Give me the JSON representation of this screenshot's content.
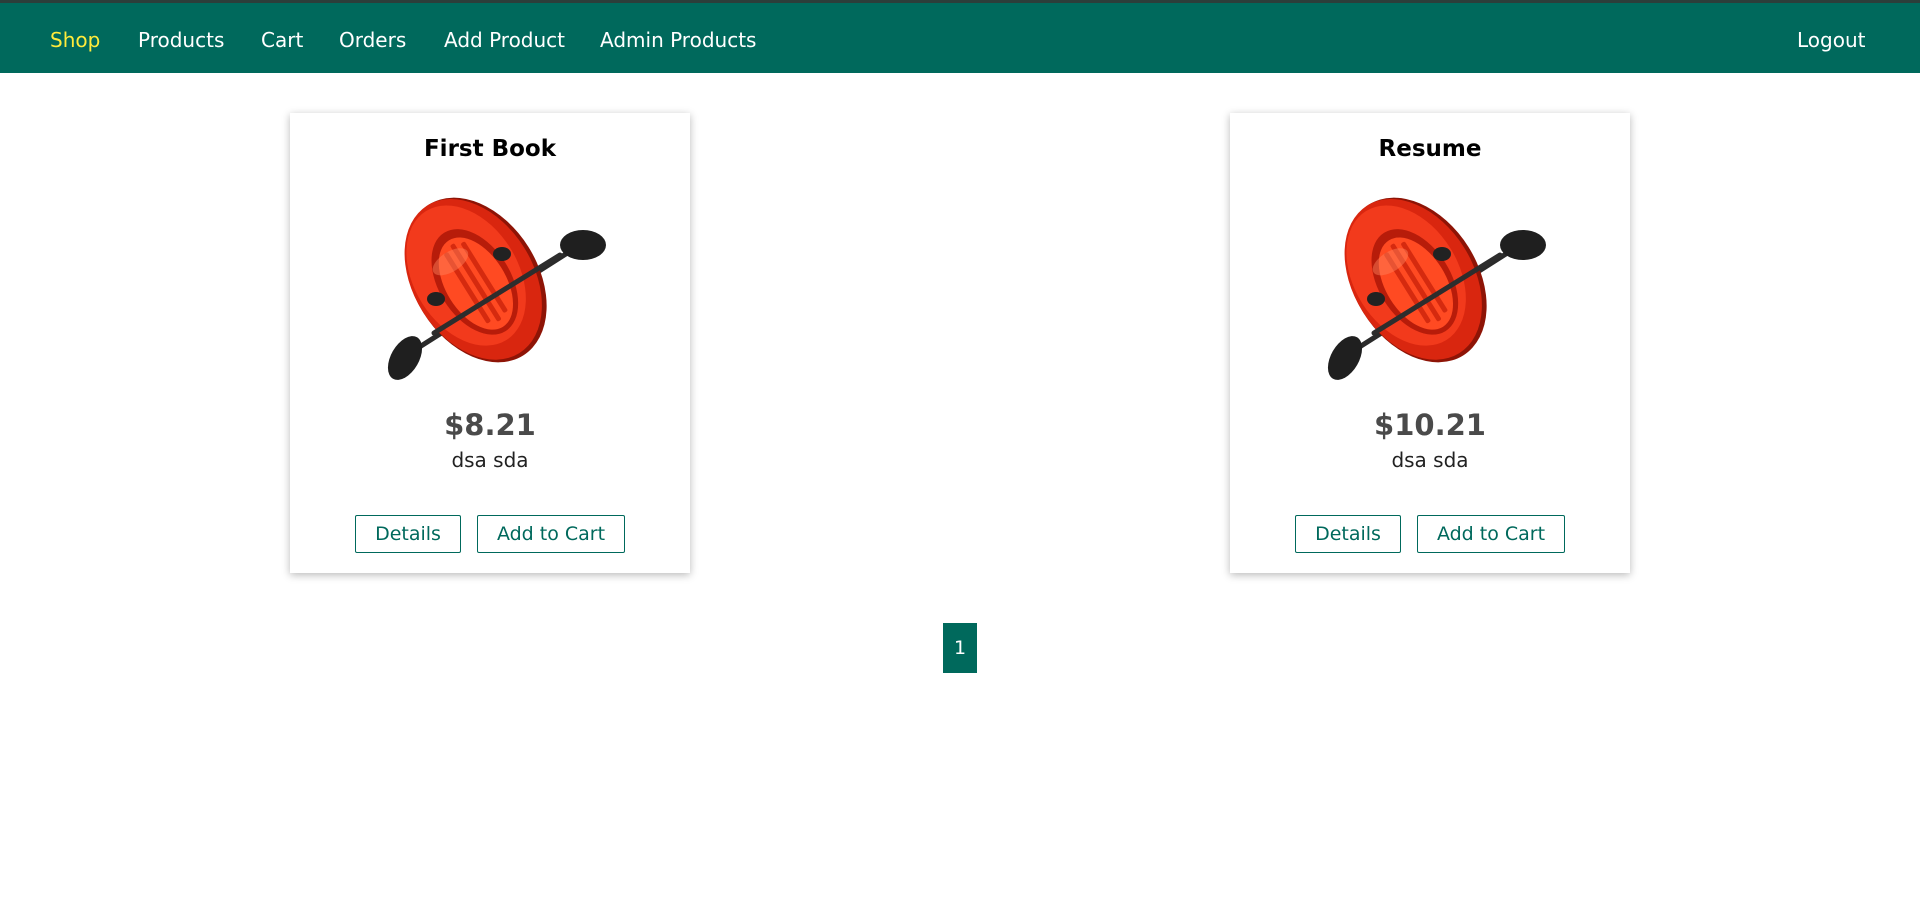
{
  "nav": {
    "items": [
      {
        "label": "Shop",
        "active": true
      },
      {
        "label": "Products"
      },
      {
        "label": "Cart"
      },
      {
        "label": "Orders"
      },
      {
        "label": "Add Product"
      },
      {
        "label": "Admin Products"
      }
    ],
    "logout": "Logout"
  },
  "products": [
    {
      "title": "First Book",
      "price": "$8.21",
      "description": "dsa sda",
      "details_label": "Details",
      "add_to_cart_label": "Add to Cart",
      "image_icon": "inflatable-boat-icon"
    },
    {
      "title": "Resume",
      "price": "$10.21",
      "description": "dsa sda",
      "details_label": "Details",
      "add_to_cart_label": "Add to Cart",
      "image_icon": "inflatable-boat-icon"
    }
  ],
  "pagination": {
    "pages": [
      "1"
    ],
    "current": "1"
  },
  "colors": {
    "header_bg": "#00695c",
    "active_nav": "#ffeb3b",
    "button_border": "#00695c"
  }
}
